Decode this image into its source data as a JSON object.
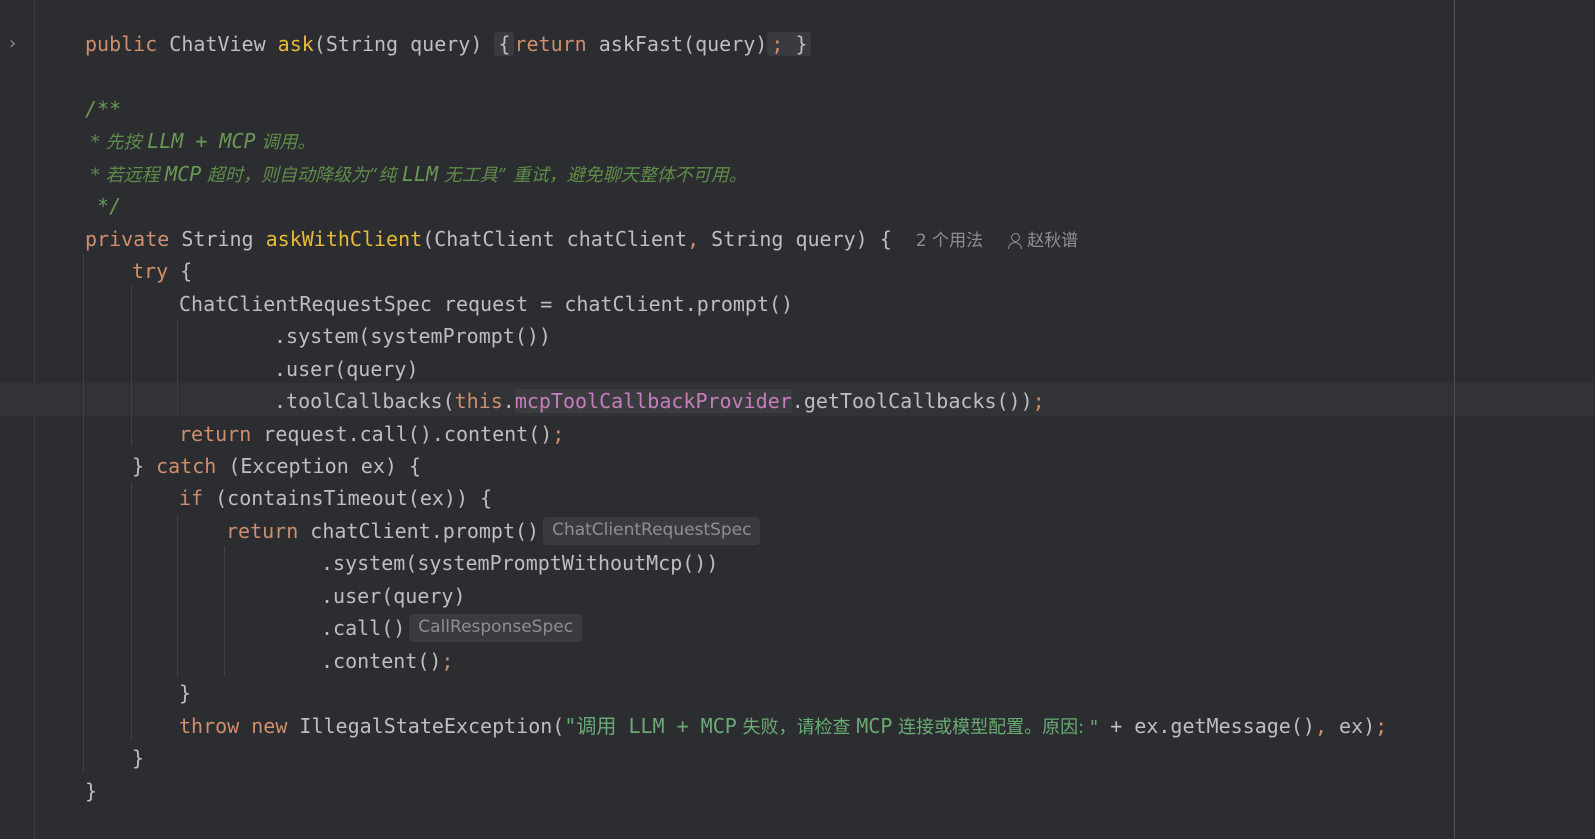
{
  "editor": {
    "hints": {
      "usages": "2 个用法",
      "author": "赵秋谱",
      "type_hint_1": "ChatClientRequestSpec",
      "type_hint_2": "CallResponseSpec"
    },
    "lines": {
      "l1": {
        "kw": "public",
        "type": "ChatView",
        "name": "ask",
        "params": "(String query)",
        "open": "{",
        "ret": "return",
        "call": "askFast(query)",
        "semi": ";",
        "close": "}"
      },
      "l3": "/**",
      "l4a": " * 先按 ",
      "l4b": "LLM + MCP",
      "l4c": " 调用。",
      "l5a": " * 若远程 ",
      "l5b": "MCP",
      "l5c": " 超时，则自动降级为“纯 ",
      "l5d": "LLM",
      "l5e": " 无工具” 重试，避免聊天整体不可用。",
      "l6": " */",
      "l7": {
        "kw": "private",
        "type": "String",
        "name": "askWithClient",
        "params": "(ChatClient chatClient",
        "comma": ",",
        "params2": " String query) {"
      },
      "l8": {
        "kw": "try",
        "rest": " {"
      },
      "l9": "ChatClientRequestSpec request = chatClient.prompt()",
      "l10": ".system(systemPrompt())",
      "l11": ".user(query)",
      "l12": {
        "pre": ".toolCallbacks(",
        "this": "this",
        "dot": ".",
        "field": "mcpToolCallbackProvider",
        "post": ".getToolCallbacks())",
        "semi": ";"
      },
      "l13": {
        "kw": "return",
        "rest": " request.call().content()",
        "semi": ";"
      },
      "l14": {
        "pre": "} ",
        "kw": "catch",
        "rest": " (Exception ex) {"
      },
      "l15": {
        "kw": "if",
        "rest": " (containsTimeout(ex)) {"
      },
      "l16": {
        "kw": "return",
        "rest": " chatClient.prompt()"
      },
      "l17": ".system(systemPromptWithoutMcp())",
      "l18": ".user(query)",
      "l19": ".call()",
      "l20": {
        "rest": ".content()",
        "semi": ";"
      },
      "l21": "}",
      "l22": {
        "kw1": "throw",
        "kw2": "new",
        "cls": " IllegalStateException(",
        "s1": "\"调用 ",
        "s2": "LLM + MCP",
        "s3": " 失败，请检查 ",
        "s4": "MCP",
        "s5": " 连接或模型配置。原因: \"",
        "rest": " + ex.getMessage()",
        "comma": ",",
        "rest2": " ex)",
        "semi": ";"
      },
      "l23": "}",
      "l24": "}"
    }
  }
}
